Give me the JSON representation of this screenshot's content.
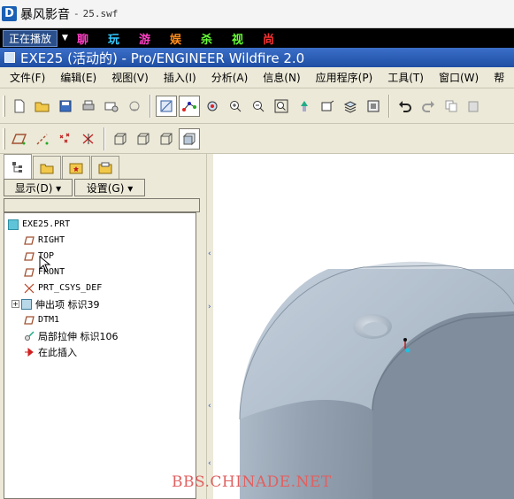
{
  "player": {
    "logo_letter": "D",
    "app_name": "暴风影音",
    "separator": "-",
    "file_name": "25.swf",
    "now_playing_label": "正在播放",
    "nav_links": [
      {
        "label": "聊",
        "color": "#ff3fc4"
      },
      {
        "label": "玩",
        "color": "#33c8ff"
      },
      {
        "label": "游",
        "color": "#ff3fc4"
      },
      {
        "label": "娱",
        "color": "#ff8c1a"
      },
      {
        "label": "杀",
        "color": "#66ff33"
      },
      {
        "label": "视",
        "color": "#66ff33"
      },
      {
        "label": "尚",
        "color": "#ff3333"
      }
    ]
  },
  "window": {
    "title": "EXE25 (活动的) - Pro/ENGINEER Wildfire 2.0"
  },
  "menu": {
    "items": [
      "文件(F)",
      "编辑(E)",
      "视图(V)",
      "插入(I)",
      "分析(A)",
      "信息(N)",
      "应用程序(P)",
      "工具(T)",
      "窗口(W)",
      "帮"
    ]
  },
  "toolbar1": {
    "icons": [
      "new-file-icon",
      "open-folder-icon",
      "save-icon",
      "print-icon",
      "send-mail-icon",
      "regenerate-icon",
      "repaint-icon",
      "spin-center-icon",
      "orient-icon",
      "zoom-in-icon",
      "zoom-out-icon",
      "refit-icon",
      "reorient-icon",
      "saved-views-icon",
      "layers-icon",
      "view-manager-icon",
      "undo-icon",
      "redo-icon",
      "copy-icon",
      "paste-icon"
    ]
  },
  "toolbar2": {
    "icons": [
      "datum-plane-display-icon",
      "datum-axis-display-icon",
      "datum-point-display-icon",
      "coordinate-system-display-icon",
      "wireframe-icon",
      "hidden-line-icon",
      "no-hidden-icon",
      "shading-icon"
    ]
  },
  "panel": {
    "tab_icons": [
      "model-tree-icon",
      "folder-browser-icon",
      "favorites-icon",
      "connections-icon"
    ],
    "display_menu": "显示(D) ▾",
    "settings_menu": "设置(G) ▾",
    "tree": [
      {
        "label": "EXE25.PRT",
        "icon": "part-icon"
      },
      {
        "label": "RIGHT",
        "icon": "datum-plane-icon"
      },
      {
        "label": "TOP",
        "icon": "datum-plane-icon"
      },
      {
        "label": "FRONT",
        "icon": "datum-plane-icon"
      },
      {
        "label": "PRT_CSYS_DEF",
        "icon": "coordinate-system-icon"
      },
      {
        "label": "伸出项 标识39",
        "icon": "extrude-icon"
      },
      {
        "label": "DTM1",
        "icon": "datum-plane-icon"
      },
      {
        "label": "局部拉伸 标识106",
        "icon": "local-push-icon"
      },
      {
        "label": "在此插入",
        "icon": "insert-here-icon"
      }
    ]
  },
  "watermark": "BBS.CHINADE.NET"
}
